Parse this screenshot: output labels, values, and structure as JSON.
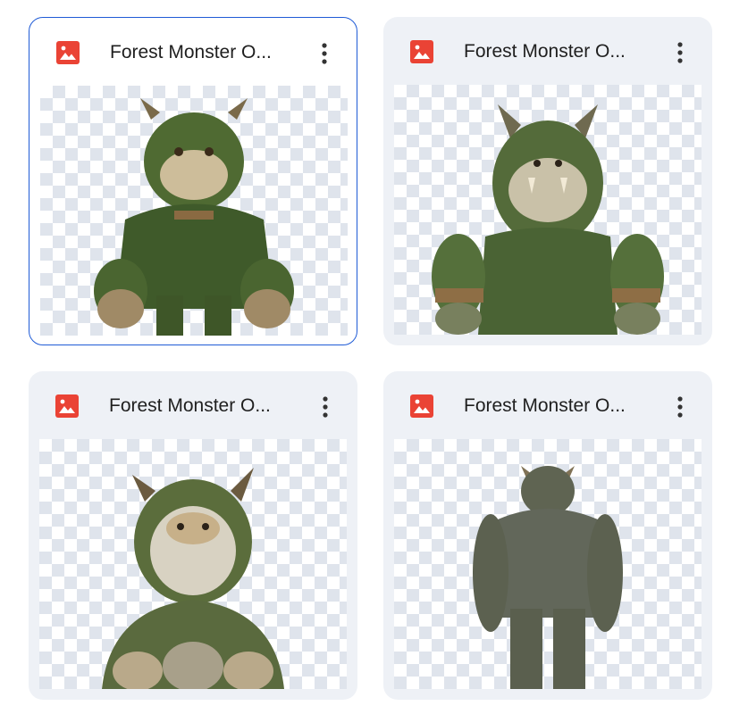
{
  "files": [
    {
      "title": "Forest Monster O...",
      "icon": "image-file-icon",
      "selected": true
    },
    {
      "title": "Forest Monster O...",
      "icon": "image-file-icon",
      "selected": false
    },
    {
      "title": "Forest Monster O...",
      "icon": "image-file-icon",
      "selected": false
    },
    {
      "title": "Forest Monster O...",
      "icon": "image-file-icon",
      "selected": false
    }
  ],
  "colors": {
    "icon_red": "#ea4335",
    "selected_border": "#1f5bd6",
    "card_bg": "#eef1f6"
  }
}
